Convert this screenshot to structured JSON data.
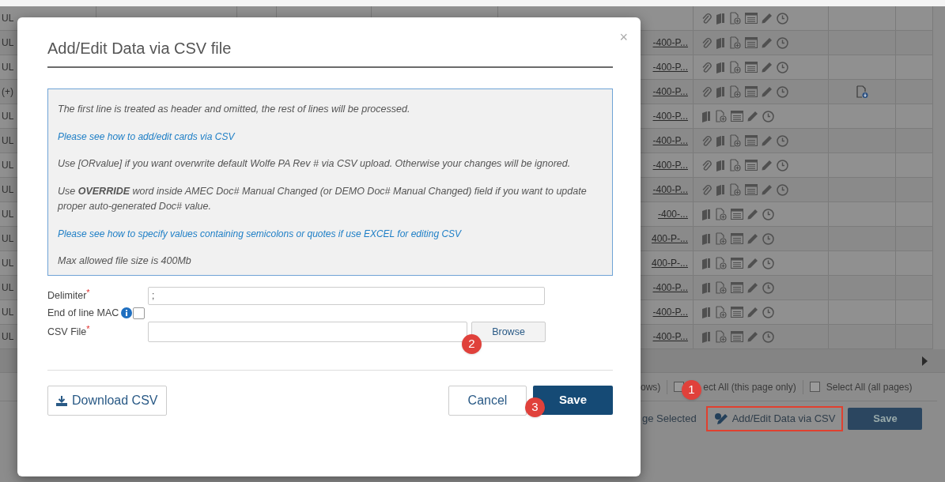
{
  "table": {
    "rows": [
      {
        "column_1": "UL",
        "attachment": true,
        "pdf": false
      },
      {
        "column_1": "UL",
        "link": "-400-P...",
        "attachment": true,
        "pdf": false
      },
      {
        "column_1": "UL",
        "link": "-400-P...",
        "attachment": true,
        "pdf": false
      },
      {
        "column_1": "(+)",
        "link": "-400-P...",
        "attachment": true,
        "pdf": true
      },
      {
        "column_1": "UL",
        "link": "-400-P...",
        "attachment": false,
        "pdf": false
      },
      {
        "column_1": "UL",
        "link": "-400-P...",
        "attachment": true,
        "pdf": false
      },
      {
        "column_1": "UL",
        "link": "-400-P...",
        "attachment": true,
        "pdf": false
      },
      {
        "column_1": "UL",
        "link": "-400-P...",
        "attachment": true,
        "pdf": false
      },
      {
        "column_1": "UL",
        "link": "-400-...",
        "attachment": false,
        "pdf": false
      },
      {
        "column_1": "UL",
        "link": "400-P-...",
        "attachment": false,
        "pdf": false
      },
      {
        "column_1": "UL",
        "link": "400-P-...",
        "attachment": false,
        "pdf": false
      },
      {
        "column_1": "UL",
        "link": "-400-P...",
        "attachment": false,
        "pdf": false
      },
      {
        "column_1": "UL",
        "link": "-400-P...",
        "attachment": false,
        "pdf": false
      },
      {
        "column_1": "UL",
        "link": "-400-P...",
        "attachment": false,
        "pdf": false
      }
    ]
  },
  "footer": {
    "count_text": "ows)",
    "select_page": {
      "label": "ect All (this page only)",
      "checked": false
    },
    "select_all": {
      "label": "Select All (all pages)",
      "checked": false
    }
  },
  "actions": {
    "change_selected": "ge Selected",
    "add_edit": "Add/Edit Data via CSV",
    "save": "Save"
  },
  "dialog": {
    "title": "Add/Edit Data via CSV file",
    "close": "×",
    "info": [
      {
        "kind": "text",
        "text": "The first line is treated as header and omitted, the rest of lines will be processed."
      },
      {
        "kind": "link",
        "text": "Please see how to add/edit cards via CSV"
      },
      {
        "kind": "text",
        "text": "Use [ORvalue] if you want overwrite default Wolfe PA Rev # via CSV upload. Otherwise your changes will be ignored."
      },
      {
        "kind": "text",
        "text": "Use **OVERRIDE** word inside AMEC Doc# Manual Changed (or DEMO Doc# Manual Changed) field if you want to update proper auto-generated Doc# value."
      },
      {
        "kind": "link",
        "text": "Please see how to specify values containing semicolons or quotes if use EXCEL for editing CSV"
      },
      {
        "kind": "text",
        "text": "Max allowed file size is 400Mb"
      }
    ],
    "delimiter": {
      "label": "Delimiter",
      "required_mark": "*",
      "value": ";"
    },
    "end_of_line_mac": {
      "label": "End of line MAC",
      "checked": false
    },
    "csv_file": {
      "label": "CSV File",
      "required_mark": "*",
      "button": "Browse"
    },
    "download": "Download CSV",
    "cancel": "Cancel",
    "save": "Save"
  },
  "badges": [
    "1",
    "2",
    "3"
  ]
}
